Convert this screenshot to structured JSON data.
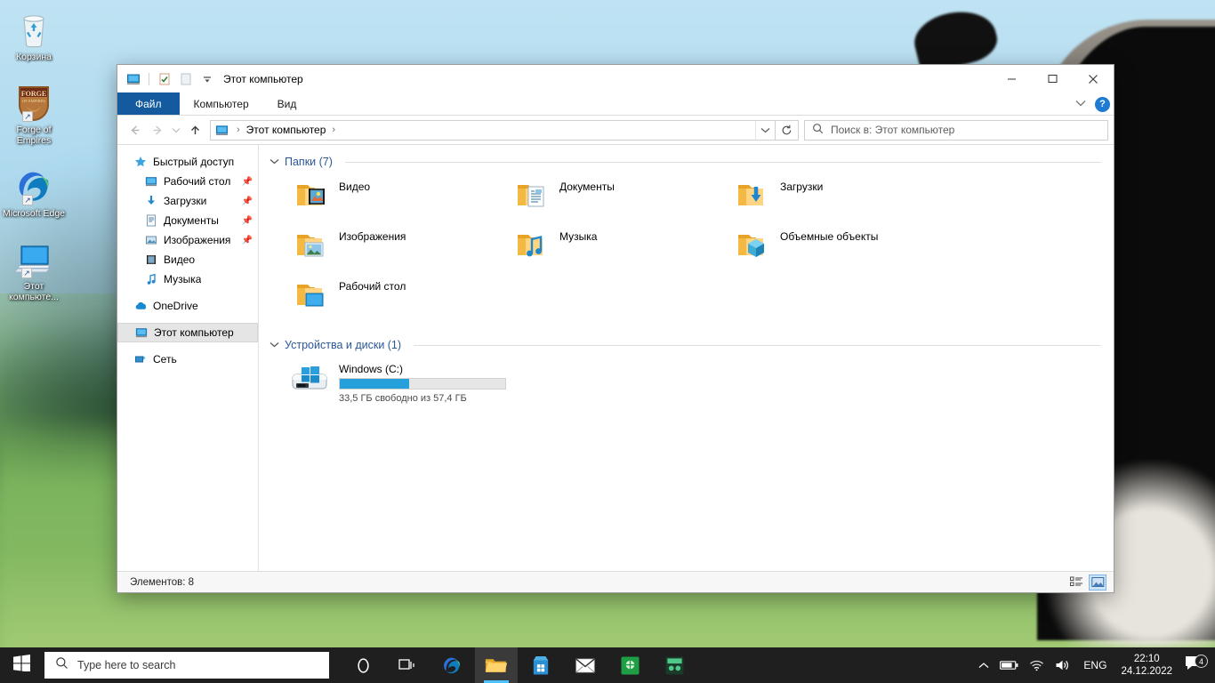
{
  "desktop": {
    "icons": [
      {
        "label": "Корзина",
        "icon": "recycle-bin-icon",
        "shortcut": false
      },
      {
        "label": "Forge of Empires",
        "icon": "forge-of-empires-icon",
        "shortcut": true
      },
      {
        "label": "Microsoft Edge",
        "icon": "microsoft-edge-icon",
        "shortcut": true
      },
      {
        "label": "Этот компьюте...",
        "icon": "this-pc-icon",
        "shortcut": true
      }
    ]
  },
  "window": {
    "title": "Этот компьютер",
    "quick_access": [
      "system-menu-icon",
      "properties-icon",
      "new-folder-icon",
      "customize-qat-icon"
    ],
    "controls": {
      "minimize": "–",
      "maximize": "☐",
      "close": "✕"
    },
    "ribbon": {
      "tabs": [
        {
          "label": "Файл",
          "active": true
        },
        {
          "label": "Компьютер",
          "active": false
        },
        {
          "label": "Вид",
          "active": false
        }
      ],
      "collapse_icon": "chevron-down-icon",
      "help_label": "?"
    },
    "nav": {
      "back_icon": "back-arrow-icon",
      "forward_icon": "forward-arrow-icon",
      "recent_icon": "recent-locations-icon",
      "up_icon": "up-arrow-icon",
      "breadcrumb": [
        "Этот компьютер"
      ],
      "dropdown_icon": "chevron-down-icon",
      "refresh_icon": "refresh-icon"
    },
    "search": {
      "placeholder": "Поиск в: Этот компьютер",
      "icon": "search-icon"
    },
    "status": {
      "items_label": "Элементов: 8",
      "views": [
        {
          "name": "details-view-button",
          "active": false
        },
        {
          "name": "large-icons-view-button",
          "active": true
        }
      ]
    }
  },
  "sidebar": {
    "items": [
      {
        "label": "Быстрый доступ",
        "icon": "star-icon",
        "indent": false,
        "pinned": false,
        "selected": false
      },
      {
        "label": "Рабочий стол",
        "icon": "desktop-icon",
        "indent": true,
        "pinned": true,
        "selected": false
      },
      {
        "label": "Загрузки",
        "icon": "downloads-icon",
        "indent": true,
        "pinned": true,
        "selected": false
      },
      {
        "label": "Документы",
        "icon": "documents-icon",
        "indent": true,
        "pinned": true,
        "selected": false
      },
      {
        "label": "Изображения",
        "icon": "pictures-icon",
        "indent": true,
        "pinned": true,
        "selected": false
      },
      {
        "label": "Видео",
        "icon": "videos-icon",
        "indent": true,
        "pinned": false,
        "selected": false
      },
      {
        "label": "Музыка",
        "icon": "music-icon",
        "indent": true,
        "pinned": false,
        "selected": false
      },
      {
        "label": "OneDrive",
        "icon": "onedrive-icon",
        "indent": false,
        "pinned": false,
        "selected": false
      },
      {
        "label": "Этот компьютер",
        "icon": "this-pc-icon",
        "indent": false,
        "pinned": false,
        "selected": true
      },
      {
        "label": "Сеть",
        "icon": "network-icon",
        "indent": false,
        "pinned": false,
        "selected": false
      }
    ]
  },
  "content": {
    "folders_group": {
      "title": "Папки (7)",
      "chevron": "chevron-down-icon",
      "items": [
        {
          "label": "Видео",
          "icon": "videos-folder-icon"
        },
        {
          "label": "Документы",
          "icon": "documents-folder-icon"
        },
        {
          "label": "Загрузки",
          "icon": "downloads-folder-icon"
        },
        {
          "label": "Изображения",
          "icon": "pictures-folder-icon"
        },
        {
          "label": "Музыка",
          "icon": "music-folder-icon"
        },
        {
          "label": "Объемные объекты",
          "icon": "3d-objects-folder-icon"
        },
        {
          "label": "Рабочий стол",
          "icon": "desktop-folder-icon"
        }
      ]
    },
    "drives_group": {
      "title": "Устройства и диски (1)",
      "chevron": "chevron-down-icon",
      "items": [
        {
          "name": "Windows (C:)",
          "icon": "windows-drive-icon",
          "free_text": "33,5 ГБ свободно из 57,4 ГБ",
          "used_percent": 42,
          "bar_color": "#26a0da"
        }
      ]
    }
  },
  "taskbar": {
    "start_icon": "windows-start-icon",
    "search": {
      "placeholder": "Type here to search",
      "icon": "search-icon"
    },
    "items": [
      {
        "name": "cortana-icon",
        "active": false
      },
      {
        "name": "task-view-icon",
        "active": false
      },
      {
        "name": "microsoft-edge-icon",
        "active": false
      },
      {
        "name": "file-explorer-icon",
        "active": true
      },
      {
        "name": "microsoft-store-icon",
        "active": false
      },
      {
        "name": "mail-icon",
        "active": false
      },
      {
        "name": "app-green-icon",
        "active": false
      },
      {
        "name": "app-dark-icon",
        "active": false
      }
    ],
    "tray": {
      "show_hidden_icon": "chevron-up-icon",
      "battery_icon": "battery-icon",
      "network_icon": "wifi-icon",
      "volume_icon": "volume-icon",
      "language": "ENG",
      "time": "22:10",
      "date": "24.12.2022",
      "notifications_icon": "notifications-icon",
      "notifications_count": "4"
    }
  }
}
